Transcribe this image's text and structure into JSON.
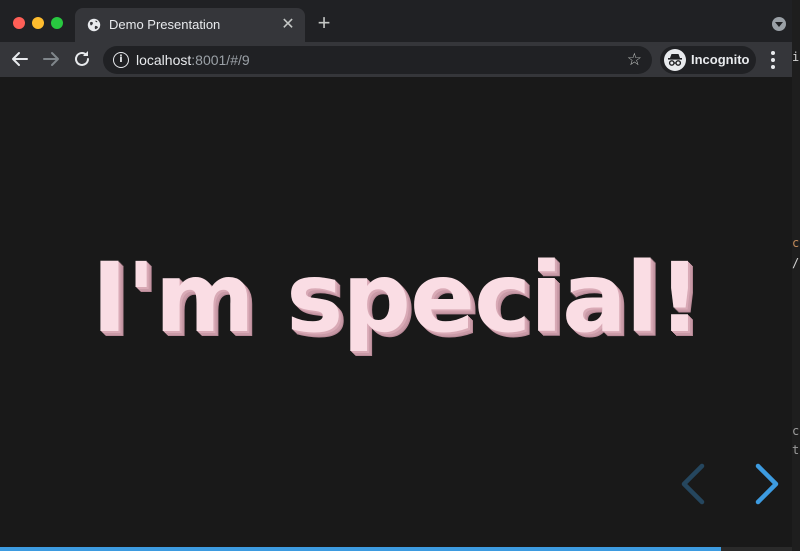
{
  "browser": {
    "tab_title": "Demo Presentation",
    "url_host": "localhost",
    "url_rest": ":8001/#/9",
    "profile_label": "Incognito"
  },
  "slide": {
    "text": "I'm special!",
    "index": 9,
    "progress": 0.91
  },
  "colors": {
    "slide_text": "#fadde4",
    "accent": "#3d9be0",
    "background": "#191919"
  },
  "icons": {
    "back": "arrow-left",
    "forward": "arrow-right",
    "reload": "reload",
    "star": "star-outline",
    "prev_slide": "chevron-left",
    "next_slide": "chevron-right"
  }
}
